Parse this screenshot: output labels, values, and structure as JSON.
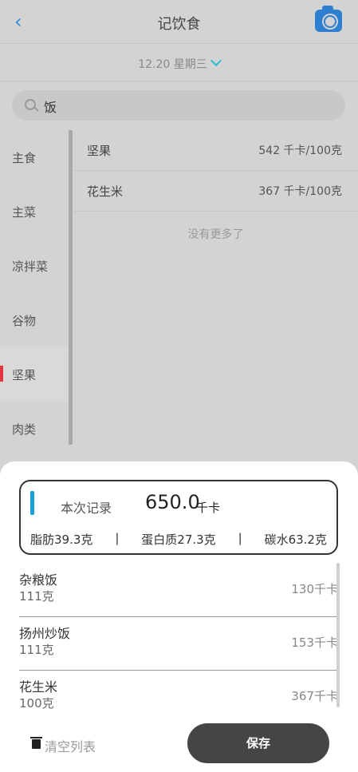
{
  "header": {
    "back_label": "‹",
    "title": "记饮食",
    "camera_icon": "camera-icon"
  },
  "date": {
    "label": "12.20 星期三"
  },
  "search": {
    "value": "饭",
    "placeholder": ""
  },
  "categories": [
    {
      "label": "主食",
      "active": false
    },
    {
      "label": "主菜",
      "active": false
    },
    {
      "label": "凉拌菜",
      "active": false
    },
    {
      "label": "谷物",
      "active": false
    },
    {
      "label": "坚果",
      "active": true
    },
    {
      "label": "肉类",
      "active": false
    }
  ],
  "foods": [
    {
      "name": "坚果",
      "kcal": "542 千卡/100克"
    },
    {
      "name": "花生米",
      "kcal": "367 千卡/100克"
    }
  ],
  "no_more": "没有更多了",
  "summary": {
    "label": "本次记录",
    "total": "650.0",
    "unit": "千卡",
    "fat": "脂肪39.3克",
    "protein": "蛋白质27.3克",
    "carbs": "碳水63.2克",
    "sep": "|"
  },
  "records": [
    {
      "name": "杂粮饭",
      "weight": "111克",
      "kcal": "130千卡"
    },
    {
      "name": "扬州炒饭",
      "weight": "111克",
      "kcal": "153千卡"
    },
    {
      "name": "花生米",
      "weight": "100克",
      "kcal": "367千卡"
    }
  ],
  "actions": {
    "clear": "清空列表",
    "save": "保存"
  },
  "colors": {
    "accent_blue": "#2f7fd1",
    "active_red": "#e2343f",
    "summary_bar": "#17a0d8",
    "save_bg": "#454545"
  }
}
